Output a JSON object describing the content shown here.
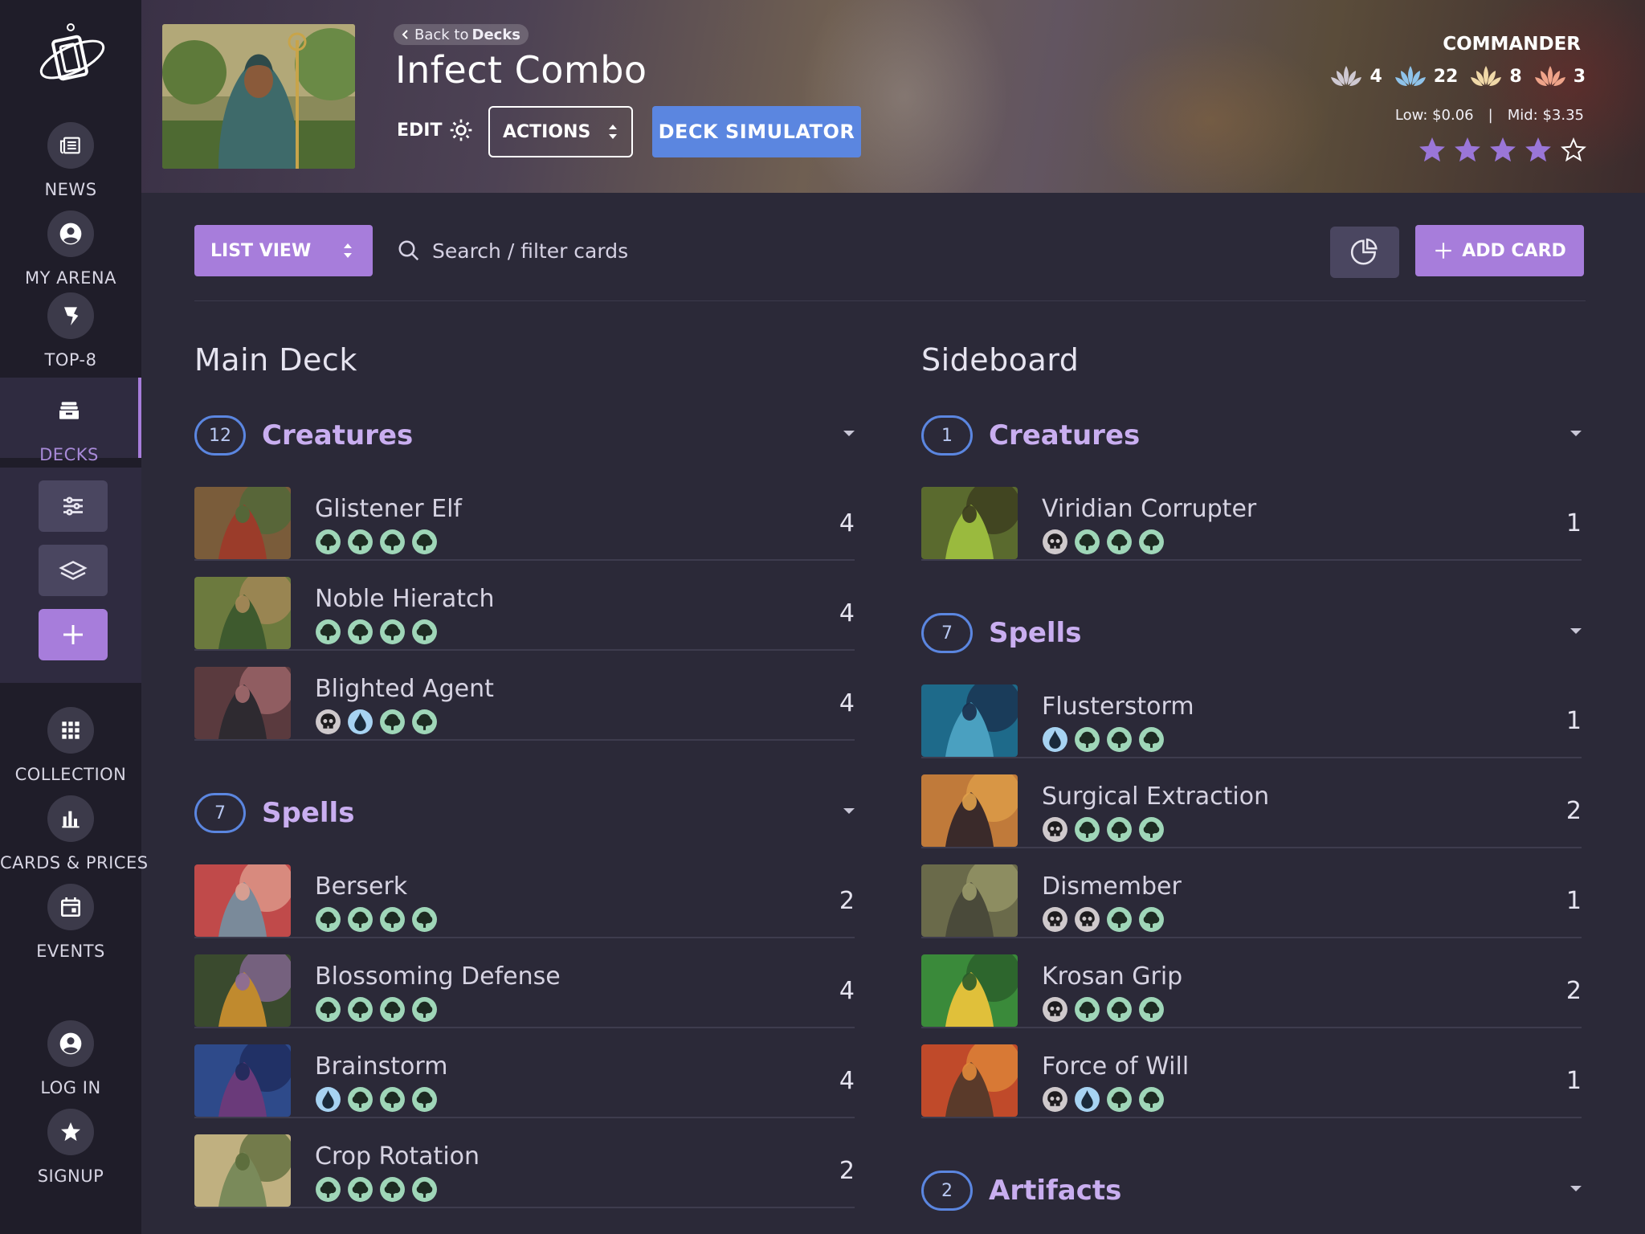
{
  "sidebar": {
    "nav": [
      {
        "label": "NEWS",
        "icon": "newspaper-icon"
      },
      {
        "label": "MY ARENA",
        "icon": "user-circle-icon"
      },
      {
        "label": "TOP-8",
        "icon": "trophy-icon"
      },
      {
        "label": "DECKS",
        "icon": "deck-box-icon",
        "active": true
      },
      {
        "label": "COLLECTION",
        "icon": "grid-icon"
      },
      {
        "label": "CARDS & PRICES",
        "icon": "bar-chart-icon"
      },
      {
        "label": "EVENTS",
        "icon": "calendar-icon"
      },
      {
        "label": "LOG IN",
        "icon": "user-circle-icon"
      },
      {
        "label": "SIGNUP",
        "icon": "star-icon"
      }
    ],
    "deck_tools": [
      "sliders-icon",
      "layers-icon",
      "plus-icon"
    ]
  },
  "header": {
    "back_prefix": "Back to",
    "back_target": "Decks",
    "deck_title": "Infect Combo",
    "edit_label": "EDIT",
    "actions_label": "ACTIONS",
    "simulator_label": "DECK SIMULATOR",
    "format": "COMMANDER",
    "color_counts": [
      {
        "color": "#cfc9d2",
        "count": "4"
      },
      {
        "color": "#8fc3ea",
        "count": "22"
      },
      {
        "color": "#f0d8a8",
        "count": "8"
      },
      {
        "color": "#f0a48a",
        "count": "3"
      }
    ],
    "price_low": "Low: $0.06",
    "price_sep": "|",
    "price_mid": "Mid: $3.35",
    "rating": 4,
    "rating_max": 5
  },
  "toolbar": {
    "view_label": "LIST VIEW",
    "search_placeholder": "Search / filter cards",
    "add_card_label": "ADD CARD"
  },
  "main_deck": {
    "title": "Main Deck",
    "groups": [
      {
        "count": "12",
        "name": "Creatures",
        "cards": [
          {
            "name": "Glistener Elf",
            "qty": "4",
            "mana": [
              "G",
              "G",
              "G",
              "G"
            ],
            "art": [
              "#7a5c3a",
              "#9b3c2a",
              "#4e6a3a"
            ]
          },
          {
            "name": "Noble Hieratch",
            "qty": "4",
            "mana": [
              "G",
              "G",
              "G",
              "G"
            ],
            "art": [
              "#6c7a3e",
              "#3e5a2e",
              "#a88a5a"
            ]
          },
          {
            "name": "Blighted Agent",
            "qty": "4",
            "mana": [
              "B",
              "U",
              "G",
              "G"
            ],
            "art": [
              "#5a3a3e",
              "#2e2a30",
              "#a36a6e"
            ]
          }
        ]
      },
      {
        "count": "7",
        "name": "Spells",
        "cards": [
          {
            "name": "Berserk",
            "qty": "2",
            "mana": [
              "G",
              "G",
              "G",
              "G"
            ],
            "art": [
              "#c04a4a",
              "#7a8a9a",
              "#e0a090"
            ]
          },
          {
            "name": "Blossoming Defense",
            "qty": "4",
            "mana": [
              "G",
              "G",
              "G",
              "G"
            ],
            "art": [
              "#3a4a2e",
              "#c08a2e",
              "#8a6a9a"
            ]
          },
          {
            "name": "Brainstorm",
            "qty": "4",
            "mana": [
              "U",
              "G",
              "G",
              "G"
            ],
            "art": [
              "#2e4a8a",
              "#6a3a7a",
              "#1e2a5a"
            ]
          },
          {
            "name": "Crop Rotation",
            "qty": "2",
            "mana": [
              "G",
              "G",
              "G",
              "G"
            ],
            "art": [
              "#c0b080",
              "#7a8a5a",
              "#5a6a3a"
            ]
          }
        ]
      }
    ]
  },
  "sideboard": {
    "title": "Sideboard",
    "groups": [
      {
        "count": "1",
        "name": "Creatures",
        "cards": [
          {
            "name": "Viridian Corrupter",
            "qty": "1",
            "mana": [
              "B",
              "G",
              "G",
              "G"
            ],
            "art": [
              "#5a6a2e",
              "#9aba3e",
              "#3a3a1e"
            ]
          }
        ]
      },
      {
        "count": "7",
        "name": "Spells",
        "cards": [
          {
            "name": "Flusterstorm",
            "qty": "1",
            "mana": [
              "U",
              "G",
              "G",
              "G"
            ],
            "art": [
              "#1e6a8a",
              "#4aa0c0",
              "#1a2e4a"
            ]
          },
          {
            "name": "Surgical Extraction",
            "qty": "2",
            "mana": [
              "B",
              "G",
              "G",
              "G"
            ],
            "art": [
              "#c07a3a",
              "#3a2a2a",
              "#e0a04a"
            ]
          },
          {
            "name": "Dismember",
            "qty": "1",
            "mana": [
              "B",
              "B",
              "G",
              "G"
            ],
            "art": [
              "#6a6a4a",
              "#4a4a3a",
              "#9a9a6a"
            ]
          },
          {
            "name": "Krosan Grip",
            "qty": "2",
            "mana": [
              "B",
              "G",
              "G",
              "G"
            ],
            "art": [
              "#3a8a3a",
              "#e0c03a",
              "#2a5a2a"
            ]
          },
          {
            "name": "Force of Will",
            "qty": "1",
            "mana": [
              "B",
              "U",
              "G",
              "G"
            ],
            "art": [
              "#c04a2a",
              "#5a3a2a",
              "#e08a3a"
            ]
          }
        ]
      },
      {
        "count": "2",
        "name": "Artifacts",
        "cards": []
      }
    ]
  }
}
